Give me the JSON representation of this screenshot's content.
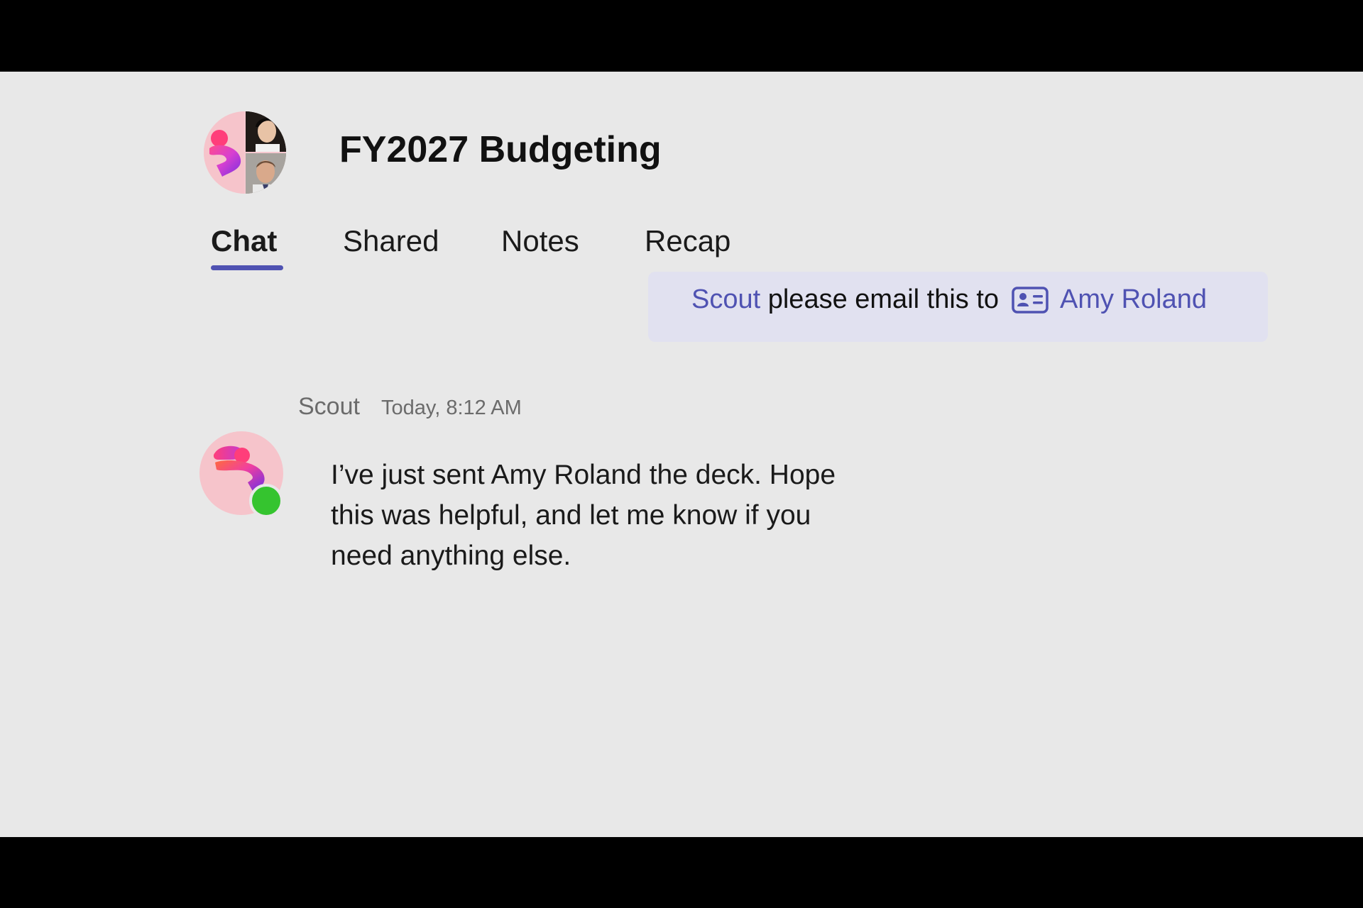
{
  "chat": {
    "title": "FY2027 Budgeting"
  },
  "tabs": [
    {
      "label": "Chat",
      "active": true
    },
    {
      "label": "Shared",
      "active": false
    },
    {
      "label": "Notes",
      "active": false
    },
    {
      "label": "Recap",
      "active": false
    }
  ],
  "request": {
    "mention": "Scout",
    "text": "please email this to",
    "recipient_icon": "contact-card-icon",
    "recipient": "Amy Roland"
  },
  "message": {
    "sender": "Scout",
    "timestamp": "Today, 8:12 AM",
    "body": "I’ve just sent Amy Roland the deck. Hope this was helpful, and let me know if you need anything else.",
    "presence": "available"
  },
  "colors": {
    "accent": "#4f52b2",
    "presence_available": "#35c42f",
    "avatar_pink": "#f6c4cb",
    "background": "#e8e8e8"
  }
}
